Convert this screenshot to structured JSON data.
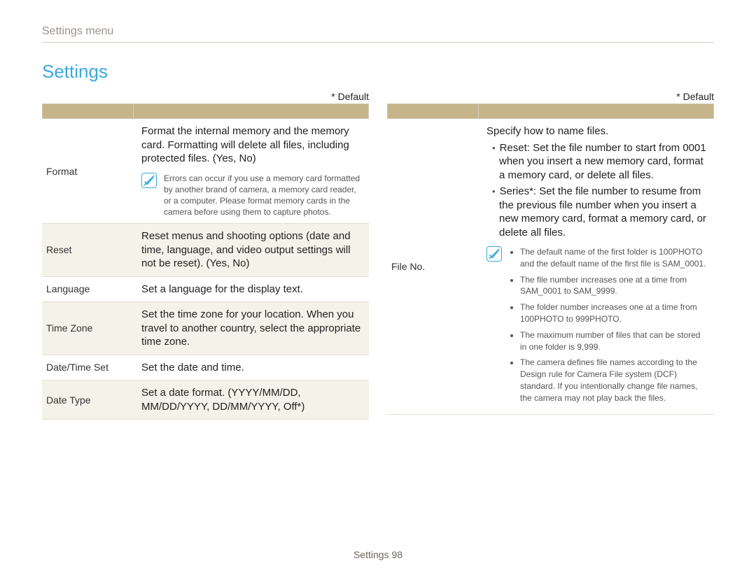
{
  "header": {
    "breadcrumb": "Settings menu",
    "title": "Settings"
  },
  "footer": {
    "label": "Settings",
    "page": "98"
  },
  "common": {
    "default_note": "* Default"
  },
  "left_table": {
    "rows": [
      {
        "item": "Format",
        "desc": "Format the internal memory and the memory card. Formatting will delete all ﬁles, including protected ﬁles. (Yes, No)",
        "note": "Errors can occur if you use a memory card formatted by another brand of camera, a memory card reader, or a computer. Please format memory cards in the camera before using them to capture photos."
      },
      {
        "item": "Reset",
        "desc": "Reset menus and shooting options (date and time, language, and video output settings will not be reset). (Yes, No)"
      },
      {
        "item": "Language",
        "desc": "Set a language for the display text."
      },
      {
        "item": "Time Zone",
        "desc": "Set the time zone for your location. When you travel to another country, select the appropriate time zone."
      },
      {
        "item": "Date/Time Set",
        "desc": "Set the date and time."
      },
      {
        "item": "Date Type",
        "desc": "Set a date format. (YYYY/MM/DD, MM/DD/YYYY, DD/MM/YYYY, Off*)"
      }
    ]
  },
  "right_table": {
    "rows": [
      {
        "item": "File No.",
        "desc_intro": "Specify how to name ﬁles.",
        "desc_bullet1": "Reset: Set the ﬁle number to start from 0001 when you insert a new memory card, format a memory card, or delete all ﬁles.",
        "desc_bullet2": "Series*: Set the ﬁle number to resume from the previous ﬁle number when you insert a new memory card, format a memory card, or delete all ﬁles.",
        "notes": [
          "The default name of the ﬁrst folder is 100PHOTO and the default name of the ﬁrst ﬁle is SAM_0001.",
          "The ﬁle number increases one at a time from SAM_0001 to SAM_9999.",
          "The folder number increases one at a time from 100PHOTO to 999PHOTO.",
          "The maximum number of ﬁles that can be stored in one folder is 9,999.",
          "The camera deﬁnes ﬁle names according to the Design rule for Camera File system (DCF) standard. If you intentionally change ﬁle names, the camera may not play back the ﬁles."
        ]
      }
    ]
  }
}
